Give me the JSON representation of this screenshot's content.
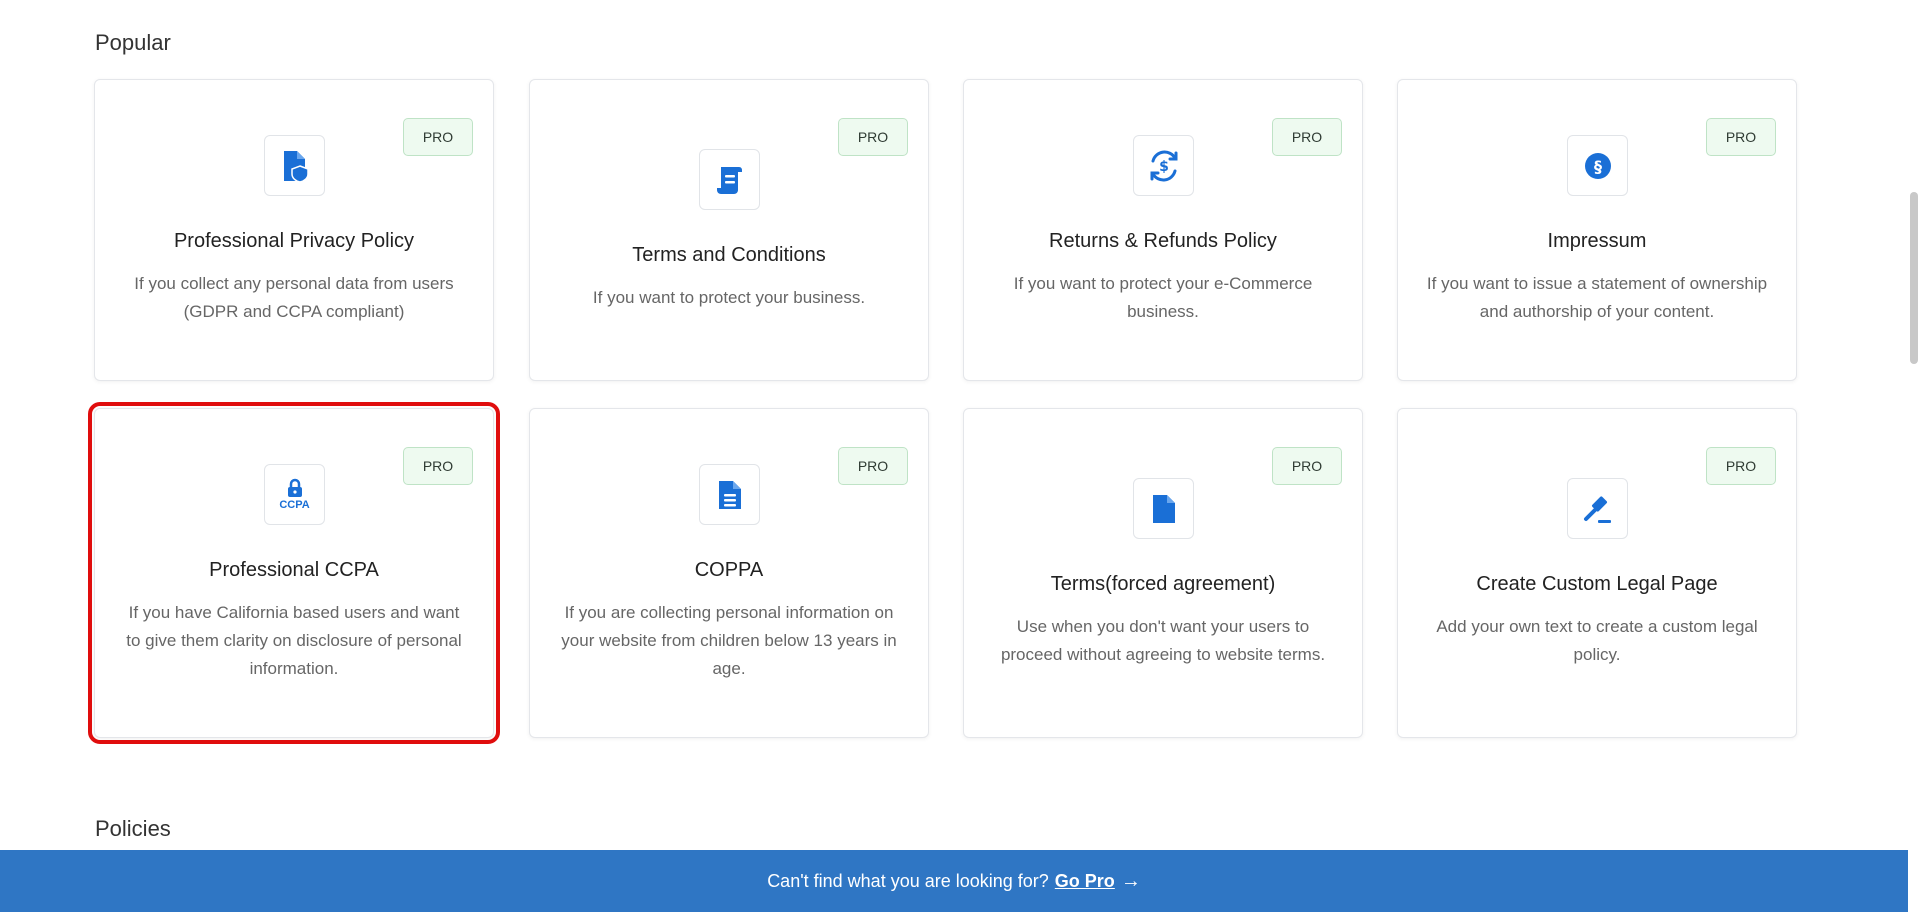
{
  "sections": {
    "popular": "Popular",
    "policies": "Policies"
  },
  "badge": "PRO",
  "cards": [
    {
      "title": "Professional Privacy Policy",
      "desc": "If you collect any personal data from users (GDPR and CCPA compliant)",
      "icon": "file-shield-icon"
    },
    {
      "title": "Terms and Conditions",
      "desc": "If you want to protect your business.",
      "icon": "scroll-icon"
    },
    {
      "title": "Returns & Refunds Policy",
      "desc": "If you want to protect your e-Commerce business.",
      "icon": "refund-dollar-icon"
    },
    {
      "title": "Impressum",
      "desc": "If you want to issue a statement of ownership and authorship of your content.",
      "icon": "section-sign-icon"
    },
    {
      "title": "Professional CCPA",
      "desc": "If you have California based users and want to give them clarity on disclosure of personal information.",
      "icon": "lock-ccpa-icon",
      "icon_text": "CCPA"
    },
    {
      "title": "COPPA",
      "desc": "If you are collecting personal information on your website from children below 13 years in age.",
      "icon": "document-lines-icon"
    },
    {
      "title": "Terms(forced agreement)",
      "desc": "Use when you don't want your users to proceed without agreeing to website terms.",
      "icon": "file-icon"
    },
    {
      "title": "Create Custom Legal Page",
      "desc": "Add your own text to create a custom legal policy.",
      "icon": "gavel-icon"
    }
  ],
  "footer": {
    "text": "Can't find what you are looking for?",
    "link": "Go Pro",
    "arrow": "→"
  },
  "colors": {
    "accent": "#1a6fd6",
    "footer_bg": "#2f76c4",
    "highlight": "#e00d0d",
    "badge_bg": "#eefaf0"
  }
}
